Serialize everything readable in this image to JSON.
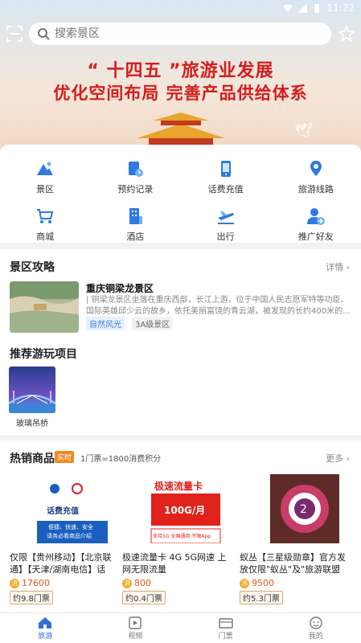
{
  "status_bar": {
    "time": "11:22"
  },
  "search": {
    "placeholder": "搜索景区"
  },
  "banner": {
    "line1": "“ 十四五 ”旅游业发展",
    "line2": "优化空间布局  完善产品供给体系"
  },
  "quick_menu": [
    {
      "label": "景区",
      "icon": "mountain-icon"
    },
    {
      "label": "预约记录",
      "icon": "booking-record-icon"
    },
    {
      "label": "话费充值",
      "icon": "phone-recharge-icon"
    },
    {
      "label": "旅游线路",
      "icon": "route-pin-icon"
    },
    {
      "label": "商城",
      "icon": "cart-icon"
    },
    {
      "label": "酒店",
      "icon": "hotel-icon"
    },
    {
      "label": "出行",
      "icon": "plane-icon"
    },
    {
      "label": "推广好友",
      "icon": "add-friend-icon"
    }
  ],
  "guide_section": {
    "title": "景区攻略",
    "more": "详情 ›",
    "attraction": {
      "name": "重庆铜梁龙景区",
      "desc": "| 铜梁龙景区坐落在重庆西部，长江上游，位于中国人民志愿军特等功臣、国际英雄邱少云的故乡，依托美丽富饶的青云湖，被发现的长约400米的...",
      "tags": [
        "自然风光",
        "3A级景区"
      ]
    }
  },
  "projects_section": {
    "title": "推荐游玩项目",
    "items": [
      {
        "name": "玻璃吊桥"
      }
    ]
  },
  "hot_goods": {
    "title": "热销商品",
    "badge": "实时",
    "note": "1门票=1800消费积分",
    "more": "更多 ›",
    "products": [
      {
        "title": "仅限【贵州移动】【北京联通】【天津/湖南电信】话费...",
        "price": "17600",
        "tickets": "约9.8门票",
        "img_text": "话费充值",
        "img_sub": "便捷、快速、安全",
        "img_sub2": "请务必看商品介绍"
      },
      {
        "title": "极速流量卡 4G 5G网速 上网无限流量",
        "price": "800",
        "tickets": "约0.4门票",
        "img_text": "极速流量卡",
        "img_sub": "100G/月",
        "img_sub2": "支持5G 全国通用 不限App"
      },
      {
        "title": "蚁丛【三星级勋章】官方发放仅限\"蚁丛\"及\"旅游联盟链\"三星...",
        "price": "9500",
        "tickets": "约5.3门票"
      }
    ]
  },
  "bottom_nav": [
    {
      "label": "旅游",
      "icon": "home-icon",
      "active": true
    },
    {
      "label": "视频",
      "icon": "video-icon",
      "active": false
    },
    {
      "label": "门票",
      "icon": "ticket-icon",
      "active": false
    },
    {
      "label": "我的",
      "icon": "profile-icon",
      "active": false
    }
  ],
  "colors": {
    "accent": "#2e6fd8",
    "banner_red": "#d41d1d",
    "price_orange": "#e8541b"
  }
}
